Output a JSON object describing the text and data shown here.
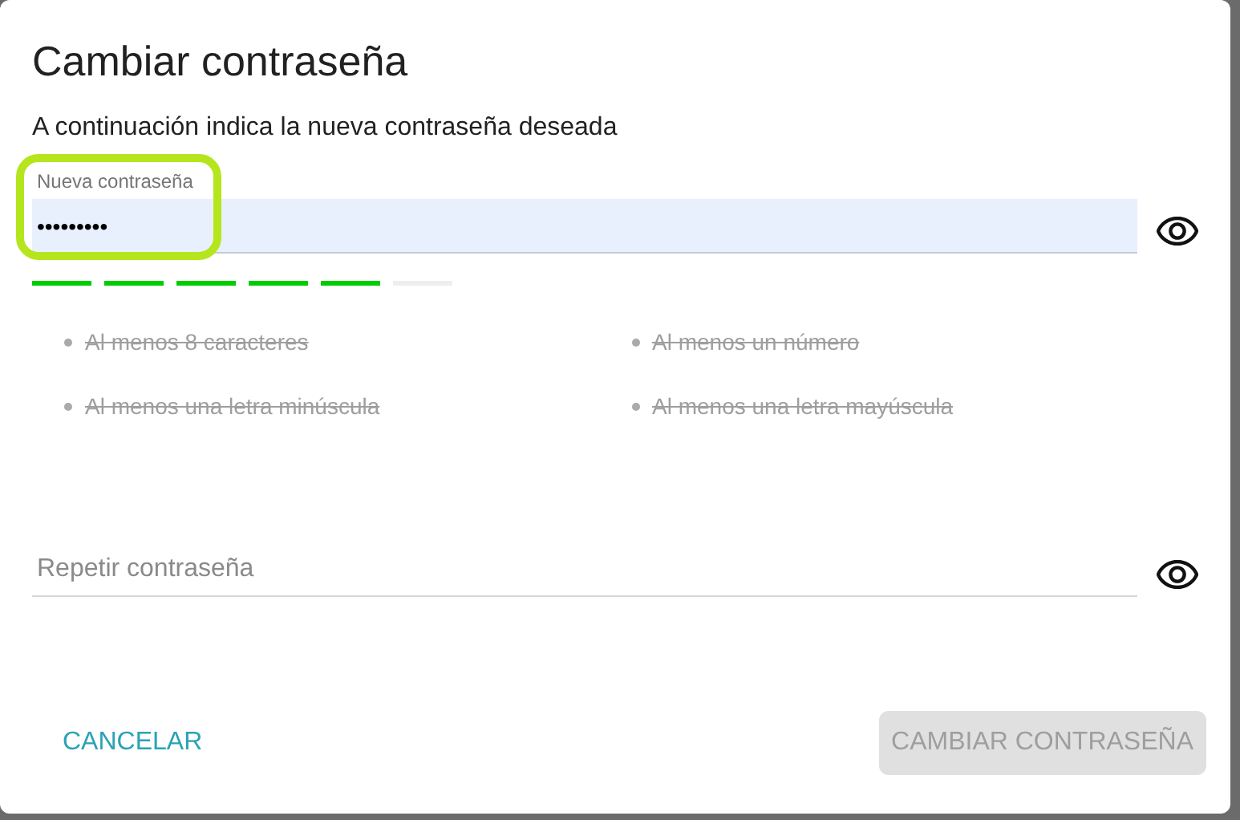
{
  "dialog": {
    "title": "Cambiar contraseña",
    "subtitle": "A continuación indica la nueva contraseña deseada"
  },
  "new_password": {
    "label": "Nueva contraseña",
    "value": "•••••••••",
    "highlighted": true,
    "strength": {
      "level": 0.8333
    }
  },
  "requirements": [
    {
      "text": "Al menos 8 caracteres",
      "met": true
    },
    {
      "text": "Al menos un número",
      "met": true
    },
    {
      "text": "Al menos una letra minúscula",
      "met": true
    },
    {
      "text": "Al menos una letra mayúscula",
      "met": true
    }
  ],
  "repeat_password": {
    "placeholder": "Repetir contraseña"
  },
  "buttons": [
    {
      "label": "CANCELAR",
      "kind": "text",
      "disabled": false
    },
    {
      "label": "CAMBIAR CONTRASEÑA",
      "kind": "filled",
      "disabled": true
    }
  ]
}
